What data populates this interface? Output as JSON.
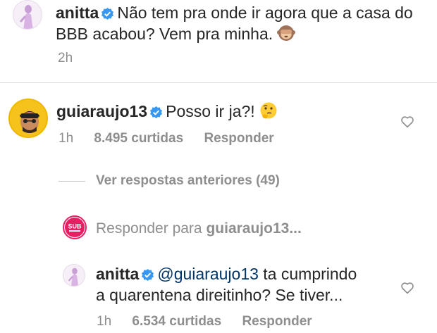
{
  "comments": [
    {
      "username": "anitta",
      "text": "Não tem pra onde ir agora que a casa do BBB acabou? Vem pra minha.",
      "emoji_icon": "see-no-evil-monkey-icon",
      "time": "2h"
    },
    {
      "username": "guiaraujo13",
      "text": "Posso ir ja?!",
      "emoji_icon": "thinking-face-icon",
      "time": "1h",
      "likes": "8.495 curtidas",
      "reply_label": "Responder"
    },
    {
      "username": "anitta",
      "mention": "@guiaraujo13",
      "text_line1": "ta cumprindo",
      "text_line2": "a quarentena direitinho? Se tiver...",
      "time": "1h",
      "likes": "6.534 curtidas",
      "reply_label": "Responder"
    }
  ],
  "view_previous_replies": "Ver respostas anteriores (49)",
  "reply_bar": {
    "avatar_text": "SUB",
    "prefix": "Responder para",
    "target": "guiaraujo13..."
  },
  "colors": {
    "text": "#262626",
    "muted": "#8e8e8e",
    "verified": "#3897f0",
    "sub_badge": "#e91e63"
  }
}
